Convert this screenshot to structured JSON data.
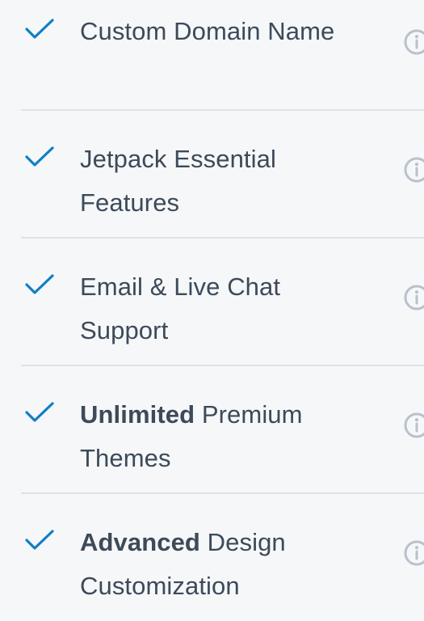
{
  "features": [
    {
      "bold": "",
      "text": "Custom Domain Name",
      "icon": "check-icon",
      "info_icon": "info-icon"
    },
    {
      "bold": "",
      "text": "Jetpack Essential Features",
      "icon": "check-icon",
      "info_icon": "info-icon"
    },
    {
      "bold": "",
      "text": "Email & Live Chat Support",
      "icon": "check-icon",
      "info_icon": "info-icon"
    },
    {
      "bold": "Unlimited",
      "text": " Premium Themes",
      "icon": "check-icon",
      "info_icon": "info-icon"
    },
    {
      "bold": "Advanced",
      "text": " Design Customization",
      "icon": "check-icon",
      "info_icon": "info-icon"
    }
  ],
  "colors": {
    "background": "#f6f7f9",
    "text": "#3d4a58",
    "check": "#0f7fc4",
    "divider": "#dbe3ea",
    "info_icon": "#b8c2cc"
  }
}
